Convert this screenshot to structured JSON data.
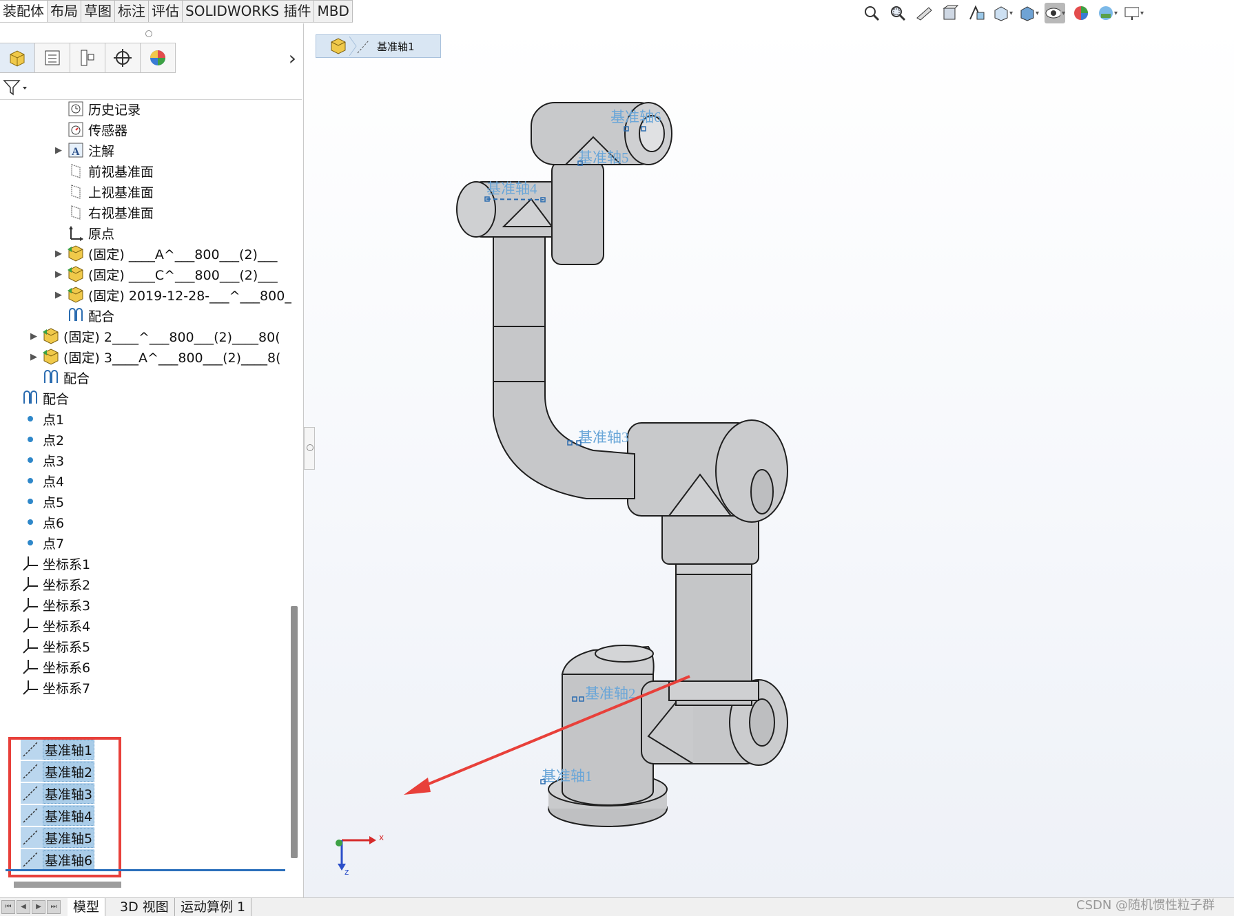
{
  "command_tabs": [
    {
      "label": "装配体",
      "active": true
    },
    {
      "label": "布局"
    },
    {
      "label": "草图"
    },
    {
      "label": "标注"
    },
    {
      "label": "评估"
    },
    {
      "label": "SOLIDWORKS 插件"
    },
    {
      "label": "MBD"
    }
  ],
  "view_toolbar_icons": [
    "zoom-to-fit-icon",
    "zoom-to-area-icon",
    "previous-view-icon",
    "section-view-icon",
    "dynamic-annotation-icon",
    "view-orientation-icon",
    "display-style-icon",
    "hide-show-items-icon",
    "edit-appearance-icon",
    "apply-scene-icon",
    "view-settings-icon"
  ],
  "breadcrumb": {
    "label": "基准轴1"
  },
  "tree": {
    "history": "历史记录",
    "sensors": "传感器",
    "annotations": "注解",
    "front_plane": "前视基准面",
    "top_plane": "上视基准面",
    "right_plane": "右视基准面",
    "origin": "原点",
    "comp1": "(固定) ____A^___800___(2)___",
    "comp2": "(固定) ____C^___800___(2)___",
    "comp3": "(固定) 2019-12-28-___^___800_",
    "mate_inner": "配合",
    "comp4": "(固定) 2____^___800___(2)____80(",
    "comp5": "(固定) 3____A^___800___(2)____8(",
    "mate_mid": "配合",
    "mate_outer": "配合",
    "points": [
      "点1",
      "点2",
      "点3",
      "点4",
      "点5",
      "点6",
      "点7"
    ],
    "coord_systems": [
      "坐标系1",
      "坐标系2",
      "坐标系3",
      "坐标系4",
      "坐标系5",
      "坐标系6",
      "坐标系7"
    ],
    "axes": [
      "基准轴1",
      "基准轴2",
      "基准轴3",
      "基准轴4",
      "基准轴5",
      "基准轴6"
    ]
  },
  "viewport": {
    "axis_labels": [
      "基准轴6",
      "基准轴5",
      "基准轴4",
      "基准轴3",
      "基准轴2",
      "基准轴1"
    ],
    "triad_x": "x",
    "triad_z": "z"
  },
  "bottom_tabs": [
    "模型",
    "3D 视图",
    "运动算例 1"
  ],
  "watermark": "CSDN @随机惯性粒子群",
  "colors": {
    "selection": "#bad6ee",
    "annotation_red": "#e8403a",
    "axis_label": "#6aa6d8",
    "part_gray": "#c8c9cb"
  }
}
